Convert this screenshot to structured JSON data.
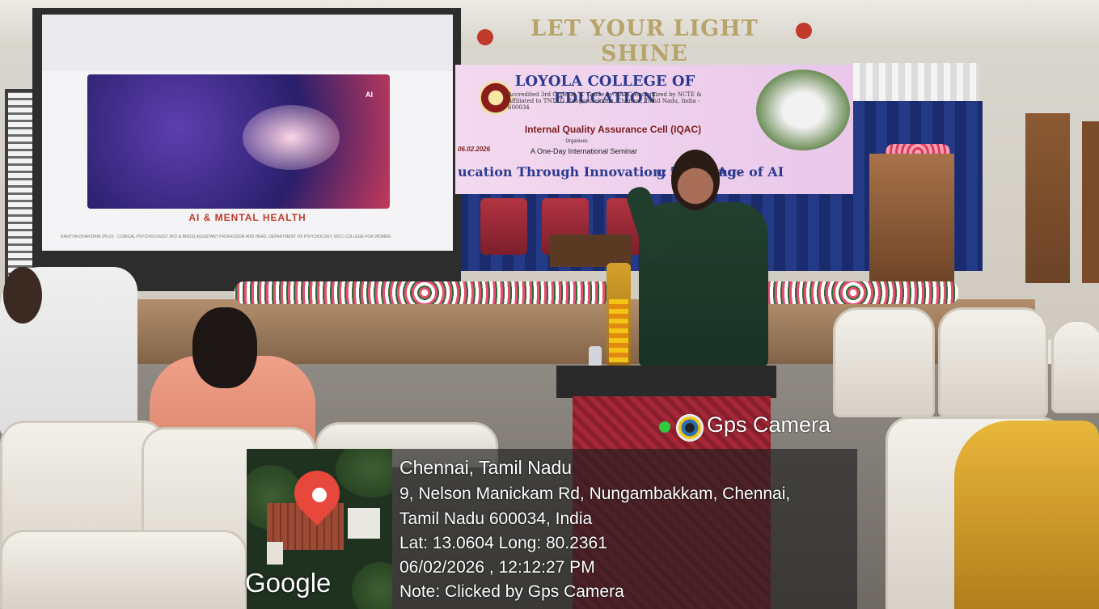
{
  "slide": {
    "title": "AI & MENTAL HEALTH",
    "ai_label": "AI",
    "footer": "RAVITHA DHAKSHINI (Ph.D) - CLINICAL PSYCHOLOGIST (RCI & BRDS) ASSISTANT PROFESSOR AND HEAD, DEPARTMENT OF PSYCHOLOGY, WCC COLLEGE FOR WOMEN"
  },
  "motto": "LET YOUR LIGHT SHINE",
  "banner": {
    "college": "LOYOLA COLLEGE OF EDUCATION",
    "accreditation": "Accredited 3rd Cycle at 'A' Grade by NAAC Recognized by NCTE & Affiliated to TNTEU Nungambakkam, Chennai, Tamil Nadu, India - 600034",
    "iqac": "Internal Quality Assurance Cell (IQAC)",
    "organises": "Organises",
    "date": "06.02.2026",
    "seminar": "A One-Day International Seminar",
    "theme_left": "ucation Through Innovation: Teaching-",
    "theme_right": "g in the Age of AI"
  },
  "gps": {
    "app_name": "Gps Camera",
    "map_brand": "Google",
    "location_title": "Chennai, Tamil Nadu",
    "address_line1": "9, Nelson Manickam Rd, Nungambakkam, Chennai,",
    "address_line2": "Tamil Nadu 600034, India",
    "coordinates": "Lat: 13.0604  Long: 80.2361",
    "datetime": "06/02/2026 , 12:12:27 PM",
    "note": "Note: Clicked by Gps Camera"
  },
  "colors": {
    "accent_green": "#2ecc40",
    "pin_red": "#e8473b"
  }
}
